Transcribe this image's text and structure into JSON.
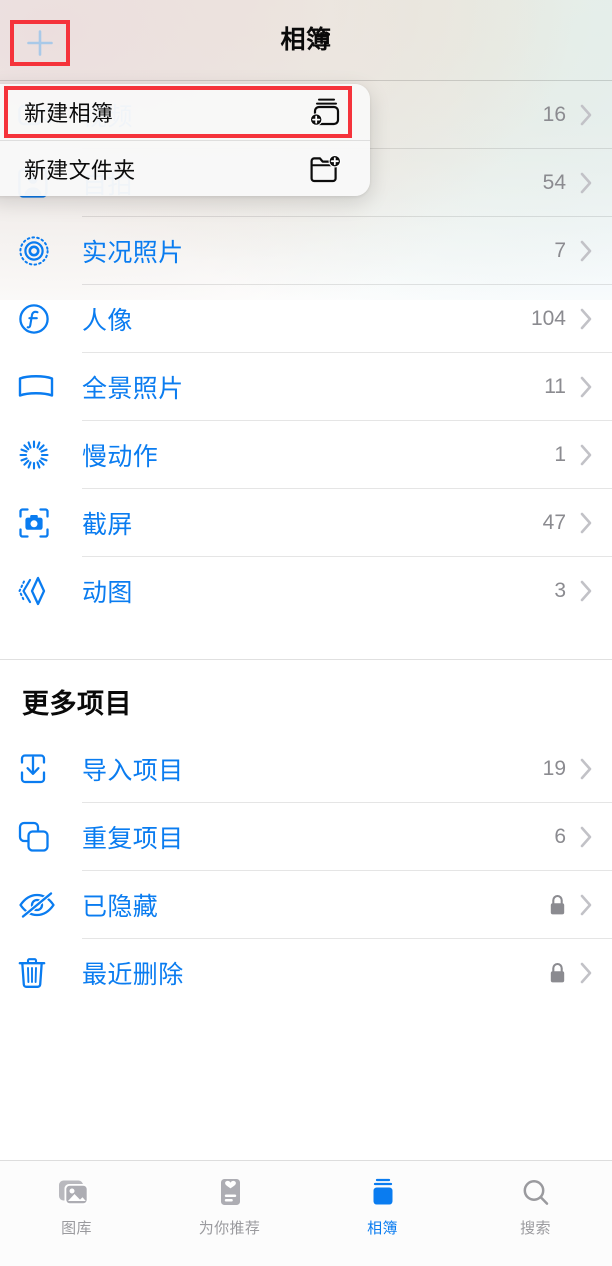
{
  "app": {
    "accent_color": "#0a7cf0",
    "muted_color": "#8b8b90",
    "annotation_color": "#f5333b"
  },
  "header": {
    "title": "相簿",
    "add_button_name": "plus-button"
  },
  "menu": {
    "items": [
      {
        "label": "新建相簿",
        "icon": "rectangle-stack-badge-plus-icon",
        "highlighted": true
      },
      {
        "label": "新建文件夹",
        "icon": "folder-badge-plus-icon",
        "highlighted": false
      }
    ]
  },
  "media_types": {
    "rows": [
      {
        "label": "视频",
        "count": "16",
        "icon": "video-camera-icon"
      },
      {
        "label": "自拍",
        "count": "54",
        "icon": "person-square-icon"
      },
      {
        "label": "实况照片",
        "count": "7",
        "icon": "live-photo-icon"
      },
      {
        "label": "人像",
        "count": "104",
        "icon": "portrait-f-icon"
      },
      {
        "label": "全景照片",
        "count": "11",
        "icon": "panorama-icon"
      },
      {
        "label": "慢动作",
        "count": "1",
        "icon": "slomo-icon"
      },
      {
        "label": "截屏",
        "count": "47",
        "icon": "screenshot-camera-icon"
      },
      {
        "label": "动图",
        "count": "3",
        "icon": "animated-image-icon"
      }
    ]
  },
  "more_section": {
    "title": "更多项目",
    "rows": [
      {
        "label": "导入项目",
        "count": "19",
        "locked": false,
        "icon": "import-tray-icon"
      },
      {
        "label": "重复项目",
        "count": "6",
        "locked": false,
        "icon": "duplicate-squares-icon"
      },
      {
        "label": "已隐藏",
        "count": "",
        "locked": true,
        "icon": "eye-slash-icon"
      },
      {
        "label": "最近删除",
        "count": "",
        "locked": true,
        "icon": "trash-icon"
      }
    ]
  },
  "tabbar": {
    "tabs": [
      {
        "label": "图库",
        "icon": "photos-stack-icon",
        "active": false
      },
      {
        "label": "为你推荐",
        "icon": "for-you-card-icon",
        "active": false
      },
      {
        "label": "相簿",
        "icon": "albums-icon",
        "active": true
      },
      {
        "label": "搜索",
        "icon": "search-icon",
        "active": false
      }
    ]
  }
}
